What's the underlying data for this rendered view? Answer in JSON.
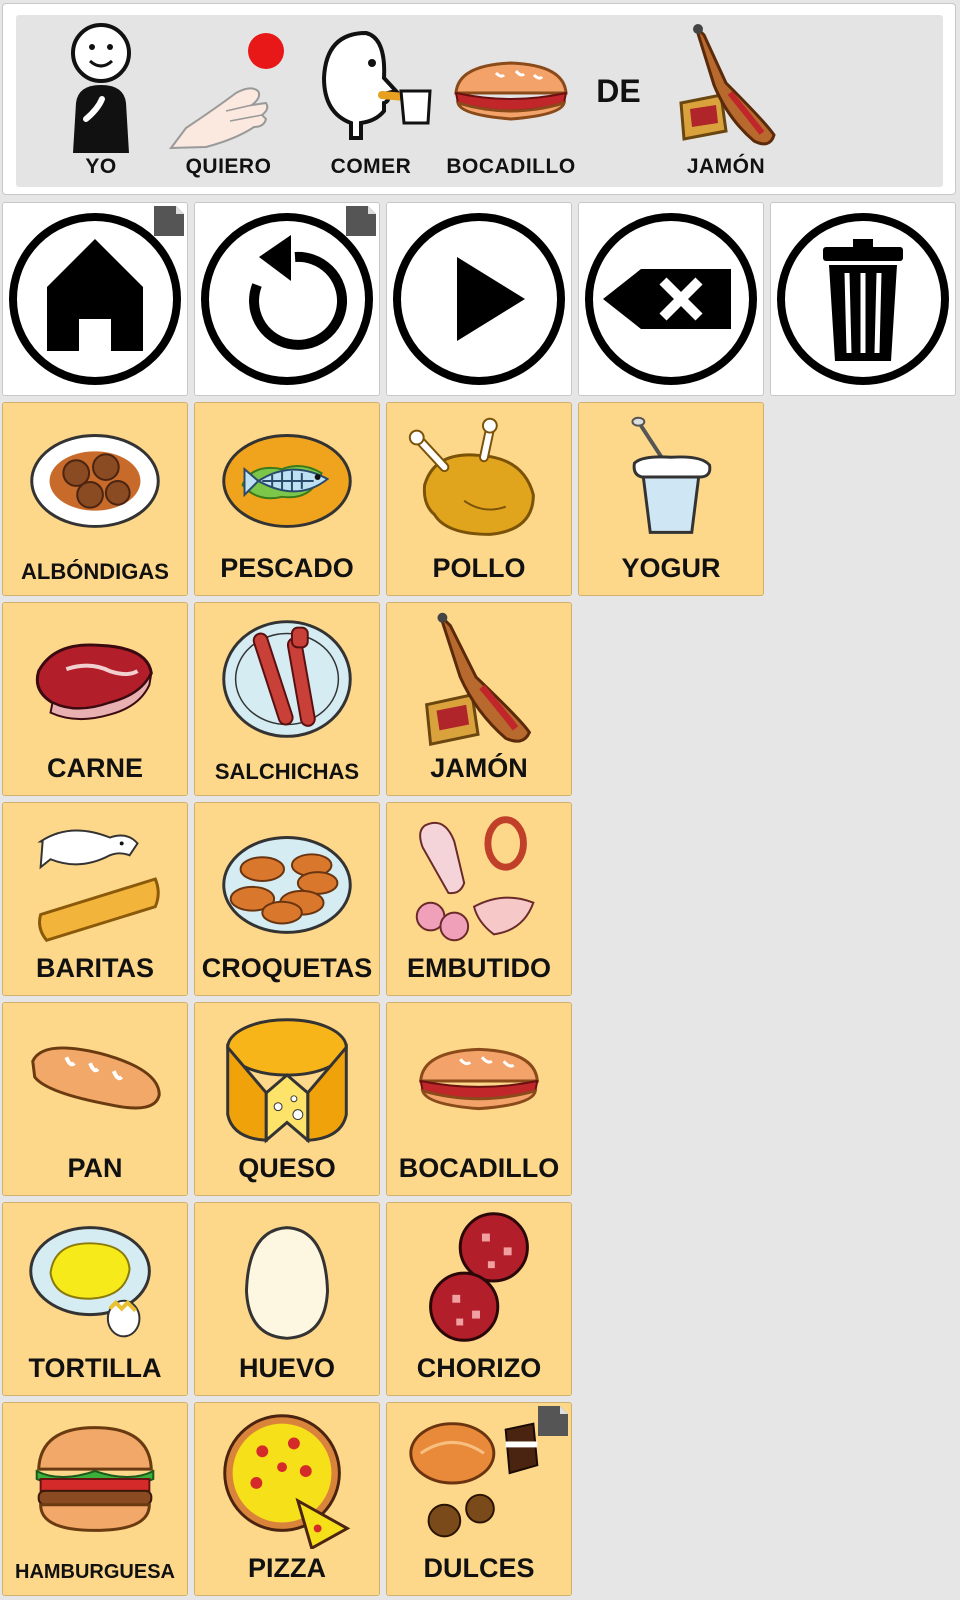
{
  "sentence": {
    "words": [
      {
        "label": "YO",
        "icon": "person-pointing-self-icon"
      },
      {
        "label": "QUIERO",
        "icon": "hand-reaching-ball-icon"
      },
      {
        "label": "COMER",
        "icon": "person-eating-icon"
      },
      {
        "label": "BOCADILLO",
        "icon": "sandwich-icon"
      },
      {
        "label": "DE",
        "icon": ""
      },
      {
        "label": "JAMÓN",
        "icon": "ham-leg-icon"
      }
    ]
  },
  "controls": [
    {
      "name": "home",
      "icon": "home-icon",
      "folder": true
    },
    {
      "name": "undo",
      "icon": "undo-icon",
      "folder": true
    },
    {
      "name": "play",
      "icon": "play-icon",
      "folder": false
    },
    {
      "name": "backspace",
      "icon": "backspace-icon",
      "folder": false
    },
    {
      "name": "clear",
      "icon": "trash-icon",
      "folder": false
    }
  ],
  "grid": {
    "row1": [
      "ALBÓNDIGAS",
      "PESCADO",
      "POLLO",
      "YOGUR"
    ],
    "row2": [
      "CARNE",
      "SALCHICHAS",
      "JAMÓN"
    ],
    "row3": [
      "BARITAS",
      "CROQUETAS",
      "EMBUTIDO"
    ],
    "row4": [
      "PAN",
      "QUESO",
      "BOCADILLO"
    ],
    "row5": [
      "TORTILLA",
      "HUEVO",
      "CHORIZO"
    ],
    "row6": [
      "HAMBURGUESA",
      "PIZZA",
      "DULCES"
    ]
  },
  "colors": {
    "cell_background": "#fdd78a",
    "control_background": "#ffffff",
    "sentence_background": "#e4e4e4",
    "page_background": "#e6e6e6"
  }
}
